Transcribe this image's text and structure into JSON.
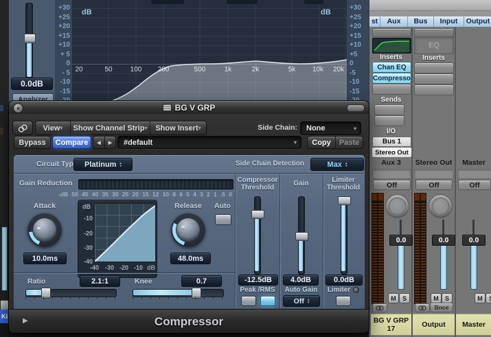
{
  "icons": {
    "close": "×",
    "caret_down": "▾",
    "stepper_up": "▴",
    "stepper_down": "▾",
    "prev": "◀",
    "next": "▶",
    "disclosure": "▶"
  },
  "left_edge": {
    "track_label": "Ki"
  },
  "eq_window": {
    "gain_value": "0.0dB",
    "analyzer_label": "Analyzer",
    "db_unit_left": "dB",
    "db_unit_right": "dB",
    "scale_left": [
      "+30",
      "+25",
      "+20",
      "+15",
      "+10",
      "+ 5",
      "0",
      "- 5",
      "-10",
      "-15",
      "-20"
    ],
    "scale_right": [
      "+30",
      "+25",
      "+20",
      "+15",
      "+10",
      "+5",
      "0",
      "-5",
      "-10",
      "-15",
      "-20"
    ],
    "freq_labels": [
      "20",
      "50",
      "100",
      "200",
      "500",
      "1k",
      "2k",
      "5k",
      "10k",
      "20k"
    ]
  },
  "window": {
    "title": "BG V GRP",
    "view_label": "View",
    "show_channel_strip_label": "Show Channel Strip",
    "show_insert_label": "Show Insert",
    "side_chain_label": "Side Chain:",
    "side_chain_value": "None",
    "bypass_label": "Bypass",
    "compare_label": "Compare",
    "preset_name": "#default",
    "copy_label": "Copy",
    "paste_label": "Paste",
    "footer_title": "Compressor"
  },
  "comp": {
    "circuit_type_label": "Circuit Type",
    "circuit_type_value": "Platinum",
    "side_chain_detection_label": "Side Chain Detection",
    "side_chain_detection_value": "Max",
    "gain_reduction_label": "Gain Reduction",
    "gr_ticks": [
      "-dB",
      "50",
      "45",
      "40",
      "35",
      "30",
      "25",
      "20",
      "15",
      "12",
      "10",
      "8",
      "6",
      "5",
      "4",
      "3",
      "2",
      "1",
      ".5",
      "0"
    ],
    "attack_label": "Attack",
    "attack_value": "10.0ms",
    "release_label": "Release",
    "release_value": "48.0ms",
    "auto_label": "Auto",
    "graph": {
      "db_unit": "dB",
      "y_ticks": [
        "-10",
        "-20",
        "-30",
        "-40"
      ],
      "x_ticks": [
        "-40",
        "-30",
        "-20",
        "-10"
      ],
      "x_unit": "dB"
    },
    "threshold_label": "Compressor Threshold",
    "threshold_value": "-12.5dB",
    "gain_label": "Gain",
    "gain_value": "4.0dB",
    "limiter_threshold_label": "Limiter Threshold",
    "limiter_threshold_value": "0.0dB",
    "peak_rms_label": "Peak /RMS",
    "auto_gain_label": "Auto Gain",
    "auto_gain_value": "Off",
    "limiter_label": "Limiter",
    "ratio_label": "Ratio",
    "ratio_value": "2.1:1",
    "knee_label": "Knee",
    "knee_value": "0.7"
  },
  "mixer": {
    "tabs": [
      "st",
      "Aux",
      "Bus",
      "Input",
      "Output"
    ],
    "strip1": {
      "inserts_label": "Inserts",
      "insert_1": "Chan EQ",
      "insert_2": "Compresso",
      "sends_label": "Sends",
      "io_label": "I/O",
      "output_1": "Bus 1",
      "output_2": "Stereo Out",
      "name": "Aux 3",
      "bypass_label": "Off",
      "fader_value": "0.0",
      "mute_label": "M",
      "solo_label": "S",
      "plate_line1": "BG V GRP",
      "plate_line2": "17"
    },
    "strip2": {
      "eq_label": "EQ",
      "inserts_label": "Inserts",
      "name": "Stereo Out",
      "bypass_label": "Off",
      "fader_value": "0.0",
      "mute_label": "M",
      "solo_label": "S",
      "bounce_label": "Bnce",
      "plate_line1": "Output"
    },
    "strip3": {
      "name": "Master",
      "bypass_label": "Off",
      "fader_value": "0.0",
      "mute_label": "M",
      "solo_label": "S",
      "plate_line1": "Master"
    }
  }
}
